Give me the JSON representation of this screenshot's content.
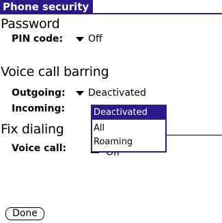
{
  "title": "Phone security",
  "password": {
    "section_label": "Password",
    "pin_label": "PIN code:",
    "pin_value": "Off"
  },
  "barring": {
    "section_label": "Voice call barring",
    "outgoing_label": "Outgoing:",
    "outgoing_value": "Deactivated",
    "incoming_label": "Incoming:",
    "popup_options": [
      "Deactivated",
      "All",
      "Roaming"
    ]
  },
  "fixdial": {
    "section_label": "Fix dialing",
    "voice_label": "Voice call:",
    "voice_value": "Off"
  },
  "done_label": "Done",
  "colors": {
    "accent": "#2a1a8a",
    "background": "#ffffff",
    "text": "#000000"
  }
}
